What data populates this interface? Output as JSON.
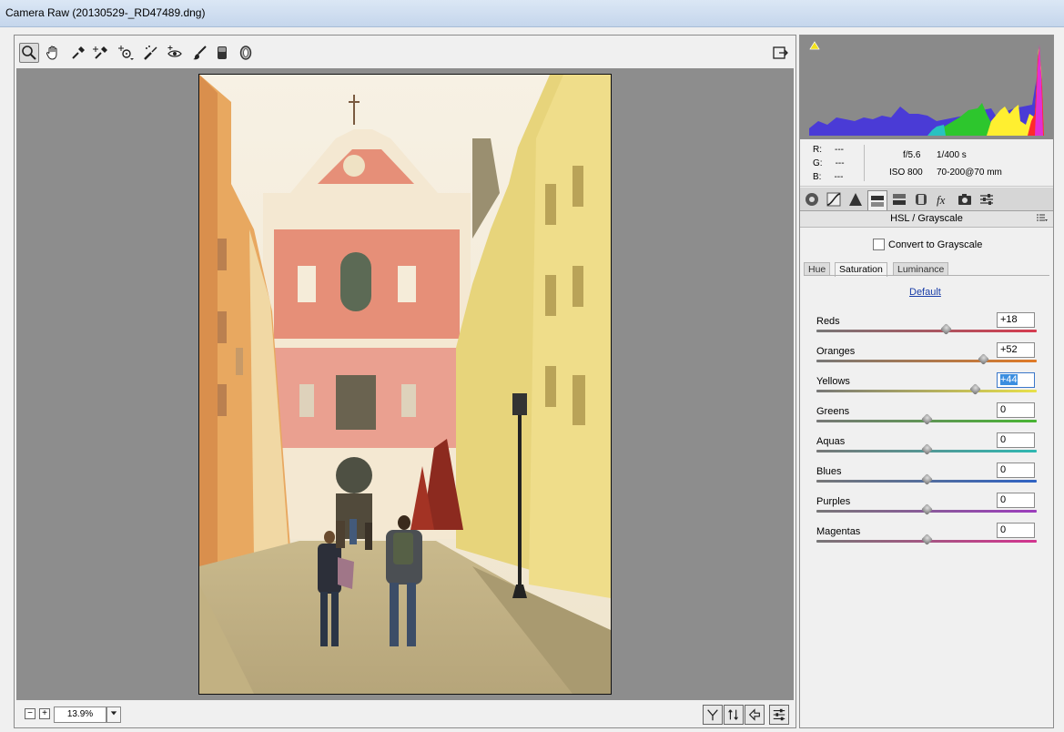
{
  "window": {
    "title": "Camera Raw (20130529-_RD47489.dng)"
  },
  "toolbar": {
    "tools": [
      {
        "name": "zoom-tool",
        "icon": "magnifier-icon",
        "active": true
      },
      {
        "name": "hand-tool",
        "icon": "hand-icon"
      },
      {
        "name": "white-balance-tool",
        "icon": "eyedropper-icon"
      },
      {
        "name": "color-sampler-tool",
        "icon": "color-sampler-icon"
      },
      {
        "name": "targeted-adjustment-tool",
        "icon": "target-adjust-icon"
      },
      {
        "name": "spot-removal-tool",
        "icon": "spot-removal-icon"
      },
      {
        "name": "red-eye-tool",
        "icon": "red-eye-icon"
      },
      {
        "name": "adjustment-brush-tool",
        "icon": "brush-icon"
      },
      {
        "name": "graduated-filter-tool",
        "icon": "graduated-filter-icon"
      },
      {
        "name": "radial-filter-tool",
        "icon": "radial-filter-icon"
      }
    ],
    "fullscreen_icon": "fullscreen-toggle-icon"
  },
  "zoom": {
    "value": "13.9%",
    "minus": "−",
    "plus": "+"
  },
  "info": {
    "r_label": "R:",
    "r_value": "---",
    "g_label": "G:",
    "g_value": "---",
    "b_label": "B:",
    "b_value": "---",
    "aperture": "f/5.6",
    "shutter": "1/400 s",
    "iso": "ISO 800",
    "lens": "70-200@70 mm"
  },
  "panel": {
    "title": "HSL / Grayscale",
    "convert_label": "Convert to Grayscale",
    "tabs": [
      "Hue",
      "Saturation",
      "Luminance"
    ],
    "active_tab": "Saturation",
    "default_link": "Default",
    "sliders": [
      {
        "label": "Reds",
        "value": "+18",
        "num": 18,
        "gradient": [
          "#777777",
          "#d63b4f"
        ]
      },
      {
        "label": "Oranges",
        "value": "+52",
        "num": 52,
        "gradient": [
          "#777777",
          "#e07a26"
        ]
      },
      {
        "label": "Yellows",
        "value": "+44",
        "num": 44,
        "gradient": [
          "#777777",
          "#e9e14a"
        ],
        "selected": true
      },
      {
        "label": "Greens",
        "value": "0",
        "num": 0,
        "gradient": [
          "#777777",
          "#48b533"
        ]
      },
      {
        "label": "Aquas",
        "value": "0",
        "num": 0,
        "gradient": [
          "#777777",
          "#2fb8b2"
        ]
      },
      {
        "label": "Blues",
        "value": "0",
        "num": 0,
        "gradient": [
          "#777777",
          "#2f63c4"
        ]
      },
      {
        "label": "Purples",
        "value": "0",
        "num": 0,
        "gradient": [
          "#777777",
          "#9c3dbd"
        ]
      },
      {
        "label": "Magentas",
        "value": "0",
        "num": 0,
        "gradient": [
          "#777777",
          "#d3348f"
        ]
      }
    ]
  },
  "colors": {
    "canvas_bg": "#8d8d8d",
    "histogram_bg": "#8a8a8a",
    "link": "#1a3ea8"
  }
}
